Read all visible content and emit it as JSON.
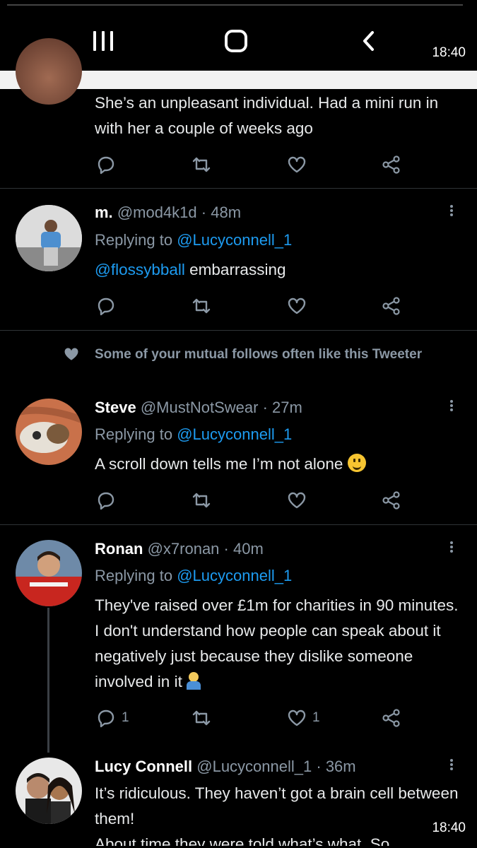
{
  "system": {
    "clock_top": "18:40",
    "clock_bottom": "18:40"
  },
  "tweet_top": {
    "text": "She’s an unpleasant individual. Had a mini run in with her a couple of weeks ago"
  },
  "tweet_mod": {
    "name": "m.",
    "handle": "@mod4k1d",
    "time": "· 48m",
    "replying_prefix": "Replying to",
    "replying_to": "@Lucyconnell_1",
    "mention": "@flossybball",
    "text": " embarrassing"
  },
  "social_context": {
    "text": "Some of your mutual follows often like this Tweeter"
  },
  "tweet_steve": {
    "name": "Steve",
    "handle": "@MustNotSwear",
    "time": "· 27m",
    "replying_prefix": "Replying to",
    "replying_to": "@Lucyconnell_1",
    "text": "A scroll down tells me I’m not alone "
  },
  "tweet_ronan": {
    "name": "Ronan",
    "handle": "@x7ronan",
    "time": "· 40m",
    "replying_prefix": "Replying to",
    "replying_to": "@Lucyconnell_1",
    "text": "They've raised over £1m for charities in 90 minutes. I don't understand how people can speak about it negatively just because they dislike someone involved in it ",
    "reply_count": "1",
    "like_count": "1"
  },
  "tweet_lucy": {
    "name": "Lucy Connell",
    "handle": "@Lucyconnell_1",
    "time": "· 36m",
    "text_line1": "It’s ridiculous. They haven’t got a brain cell between them!",
    "text_line2": "About time they were told what’s what. So"
  },
  "colors": {
    "background": "#000000",
    "link": "#1d9bf0",
    "muted": "#8b98a5"
  }
}
